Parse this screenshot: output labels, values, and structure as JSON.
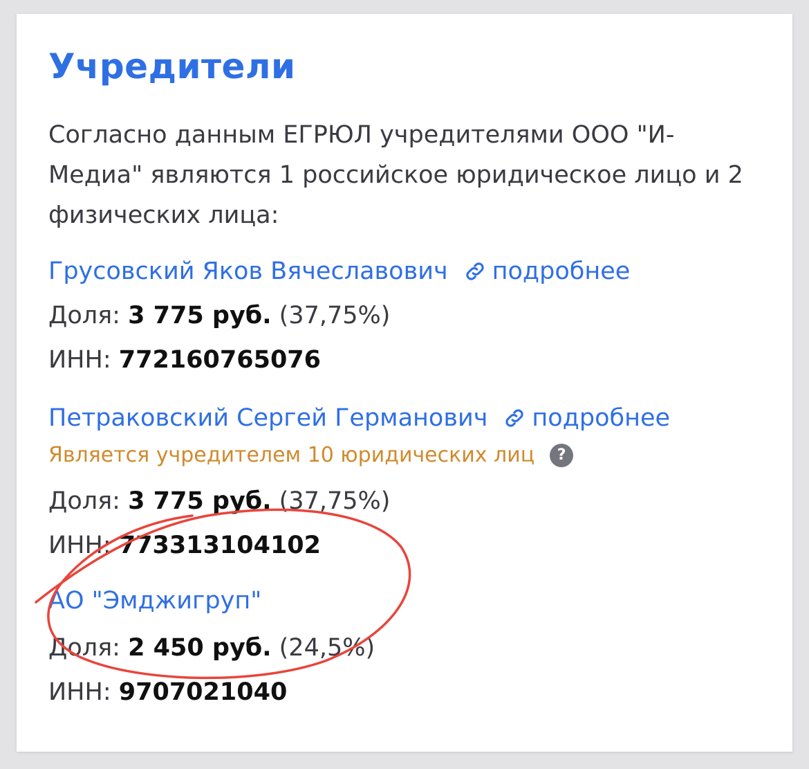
{
  "section": {
    "title": "Учредители",
    "intro": "Согласно данным ЕГРЮЛ учредителями ООО \"И-Медиа\" являются 1 российское юридическое лицо и 2 физических лица:"
  },
  "labels": {
    "share": "Доля:",
    "inn": "ИНН:",
    "more": "подробнее"
  },
  "founders": [
    {
      "name": "Грусовский Яков Вячеславович",
      "share_amount": "3 775 руб.",
      "share_percent": "(37,75%)",
      "inn": "772160765076"
    },
    {
      "name": "Петраковский Сергей Германович",
      "note": "Является учредителем 10 юридических лиц",
      "note_help": "?",
      "share_amount": "3 775 руб.",
      "share_percent": "(37,75%)",
      "inn": "773313104102"
    },
    {
      "name": "АО \"Эмджигруп\"",
      "share_amount": "2 450 руб.",
      "share_percent": "(24,5%)",
      "inn": "9707021040"
    }
  ],
  "colors": {
    "link": "#2f6fe4",
    "note": "#d08a2e",
    "annotation": "#e8453c"
  },
  "icons": [
    "link-icon",
    "help-icon"
  ]
}
